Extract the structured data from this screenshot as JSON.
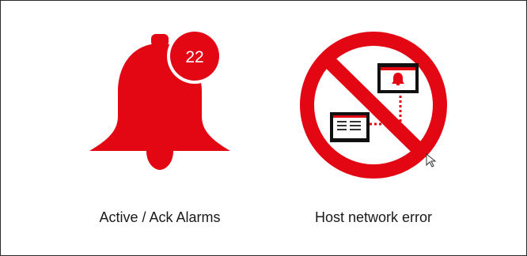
{
  "tiles": {
    "alarms": {
      "count": "22",
      "label": "Active / Ack Alarms",
      "icon": "bell-icon"
    },
    "network": {
      "label": "Host network error",
      "icon": "no-network-icon"
    }
  },
  "colors": {
    "accent": "#e30613",
    "text": "#1a1a1a",
    "border": "#2a2a2a"
  }
}
